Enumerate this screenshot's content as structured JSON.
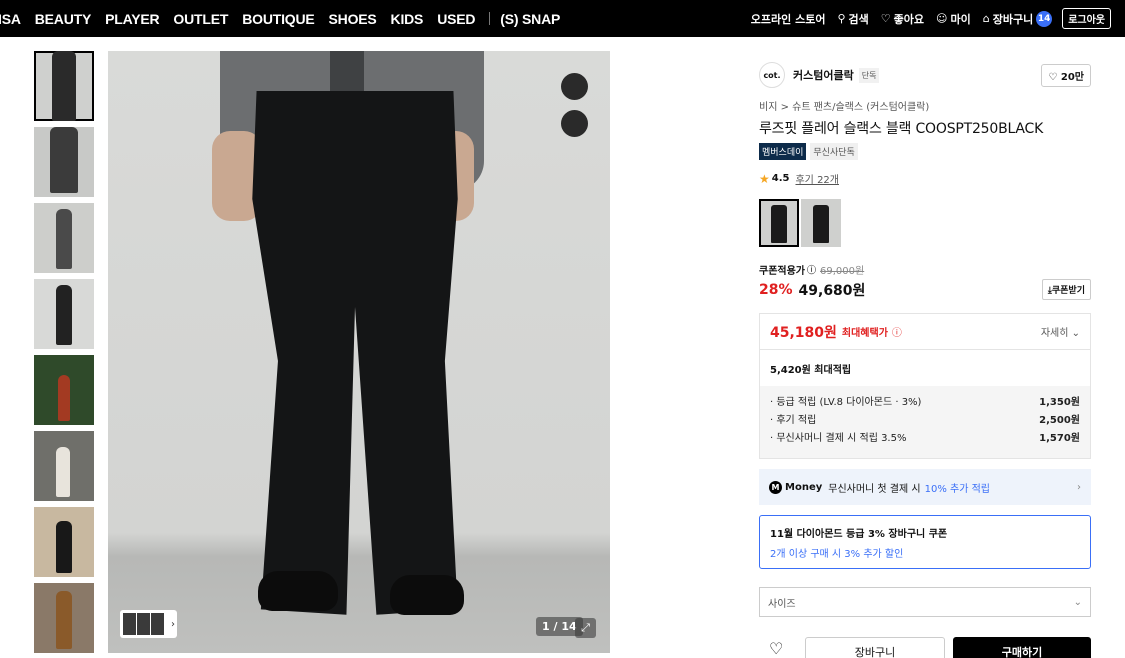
{
  "nav": {
    "items": [
      "ISA",
      "BEAUTY",
      "PLAYER",
      "OUTLET",
      "BOUTIQUE",
      "SHOES",
      "KIDS",
      "USED"
    ],
    "snap": "(S) SNAP",
    "right": {
      "offline": "오프라인 스토어",
      "search": "검색",
      "like": "좋아요",
      "my": "마이",
      "cart": "장바구니",
      "cart_count": "14",
      "logout": "로그아웃"
    }
  },
  "gallery": {
    "counter": "1 / 14"
  },
  "product": {
    "brand_logo": "cot.",
    "brand": "커스텀어클락",
    "brand_tag": "단독",
    "likes": "20만",
    "breadcrumb": "비지 > 슈트 팬츠/슬랙스 (커스텀어클락)",
    "title": "루즈핏 플레어 슬랙스 블랙 COOSPT250BLACK",
    "badge_member": "멤버스데이",
    "badge_exclusive": "무신사단독",
    "rating": "4.5",
    "reviews": "후기 22개",
    "price_label": "쿠폰적용가",
    "original_price": "69,000원",
    "discount": "28%",
    "price": "49,680원",
    "coupon_button": "쿠폰받기"
  },
  "benefit": {
    "max_price": "45,180원",
    "max_label": "최대혜택가",
    "detail": "자세히",
    "max_points": "5,420원 최대적립",
    "rows": [
      {
        "label": "· 등급 적립 (LV.8 다이아몬드 · 3%)",
        "value": "1,350원"
      },
      {
        "label": "· 후기 적립",
        "value": "2,500원"
      },
      {
        "label": "· 무신사머니 결제 시 적립 3.5%",
        "value": "1,570원"
      }
    ]
  },
  "money": {
    "word": "Money",
    "text": "무신사머니 첫 결제 시",
    "highlight": "10% 추가 적립"
  },
  "coupon": {
    "title": "11월 다이아몬드 등급 3% 장바구니 쿠폰",
    "sub": "2개 이상 구매 시 3% 추가 할인"
  },
  "size": {
    "placeholder": "사이즈"
  },
  "actions": {
    "cart": "장바구니",
    "buy": "구매하기"
  },
  "colors": {
    "accent": "#3a6ff7",
    "sale": "#e02020",
    "nav_bg": "#000000"
  }
}
